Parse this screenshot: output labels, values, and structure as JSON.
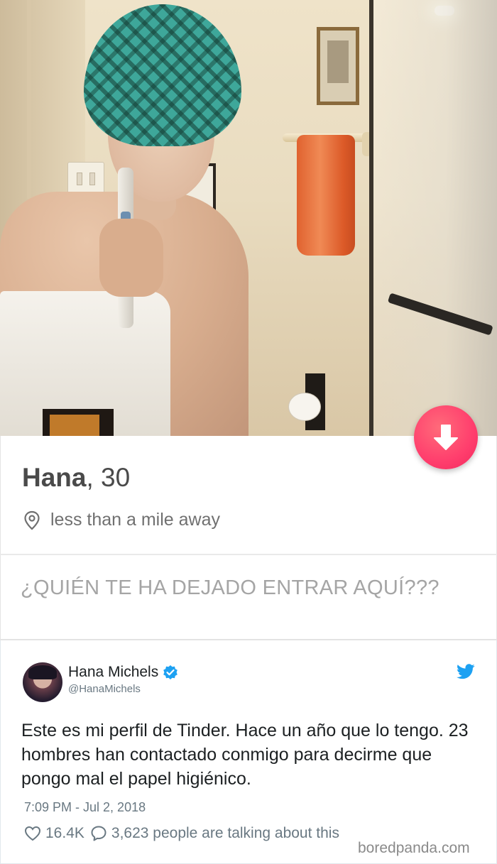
{
  "profile": {
    "name": "Hana",
    "age": "30",
    "distance": "less than a mile away",
    "bio": "¿QUIÉN TE HA DEJADO ENTRAR AQUÍ???"
  },
  "actions": {
    "down_icon": "arrow-down-icon",
    "down_color": "#ff3e6d"
  },
  "tweet": {
    "author_name": "Hana Michels",
    "handle": "@HanaMichels",
    "text": "Este es mi perfil de Tinder. Hace un año que lo tengo. 23 hombres han contactado conmigo para decirme que pongo mal el papel higiénico.",
    "timestamp": "7:09 PM - Jul 2, 2018",
    "likes": "16.4K",
    "talking": "3,623 people are talking about this",
    "verified_color": "#1da1f2",
    "bird_color": "#1da1f2"
  },
  "watermark": "boredpanda.com"
}
